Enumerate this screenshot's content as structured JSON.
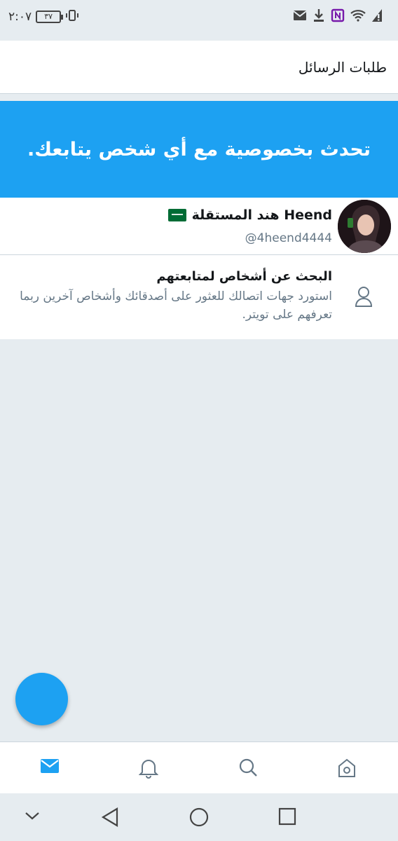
{
  "status_bar": {
    "time": "٢:٠٧",
    "battery": "٣٧",
    "icons": [
      "vibrate-icon",
      "mail-icon",
      "download-icon",
      "onenote-icon",
      "wifi-icon",
      "signal-alert-icon"
    ]
  },
  "header": {
    "title": "طلبات الرسائل"
  },
  "banner": {
    "text": "تحدث بخصوصية مع أي شخص يتابعك."
  },
  "profile": {
    "name": "Heend هند المستقلة",
    "handle": "@4heend4444",
    "flag": "saudi-flag-icon"
  },
  "suggestion": {
    "title": "البحث عن أشخاص لمتابعتهم",
    "body": "استورد جهات اتصالك للعثور على أصدقائك وأشخاص آخرين ربما تعرفهم على تويتر."
  },
  "bottom_nav": {
    "items": [
      "mail-icon",
      "bell-icon",
      "search-icon",
      "home-icon"
    ],
    "active": "mail-icon"
  },
  "colors": {
    "accent": "#1da1f2",
    "background": "#e6ecf0",
    "secondary_text": "#657786"
  }
}
